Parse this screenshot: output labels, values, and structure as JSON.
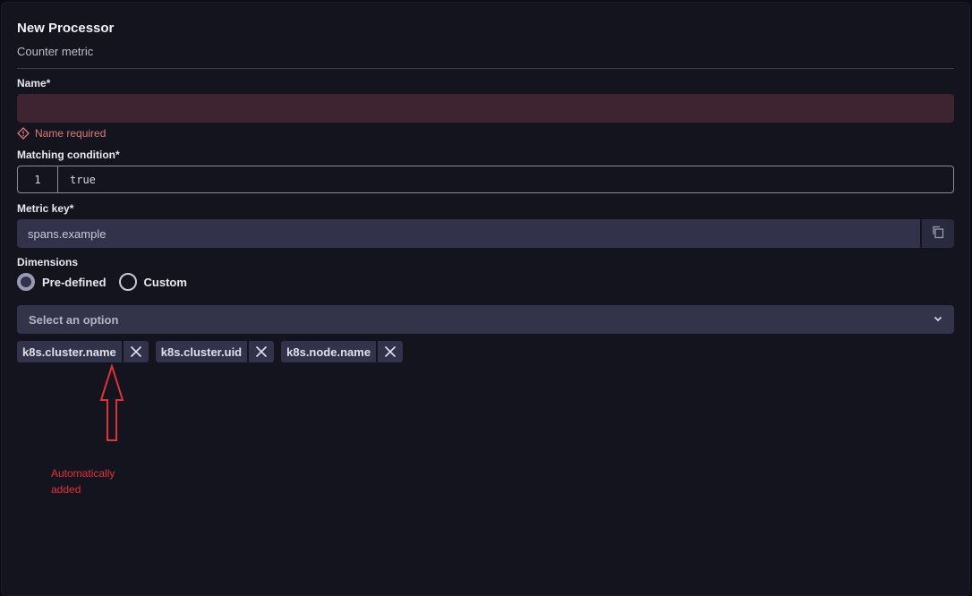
{
  "header": {
    "title": "New Processor",
    "subtitle": "Counter metric"
  },
  "fields": {
    "name_label": "Name*",
    "name_value": "",
    "name_error": "Name required",
    "matching_label": "Matching condition*",
    "matching_line_number": "1",
    "matching_code": "true",
    "metric_key_label": "Metric key*",
    "metric_key_value": "spans.example",
    "dimensions_label": "Dimensions",
    "radio_predefined": "Pre-defined",
    "radio_custom": "Custom",
    "radio_selected": "Pre-defined",
    "select_placeholder": "Select an option"
  },
  "chips": [
    {
      "label": "k8s.cluster.name"
    },
    {
      "label": "k8s.cluster.uid"
    },
    {
      "label": "k8s.node.name"
    }
  ],
  "annotation": {
    "text_line1": "Automatically",
    "text_line2": "added",
    "color": "#e0323c"
  },
  "icons": {
    "error": "warning-diamond-icon",
    "copy": "copy-icon",
    "select": "chevron-down-icon",
    "chip_remove": "close-icon"
  },
  "colors": {
    "background": "#14141f",
    "error": "#e07a7a",
    "input": "#32324a"
  }
}
